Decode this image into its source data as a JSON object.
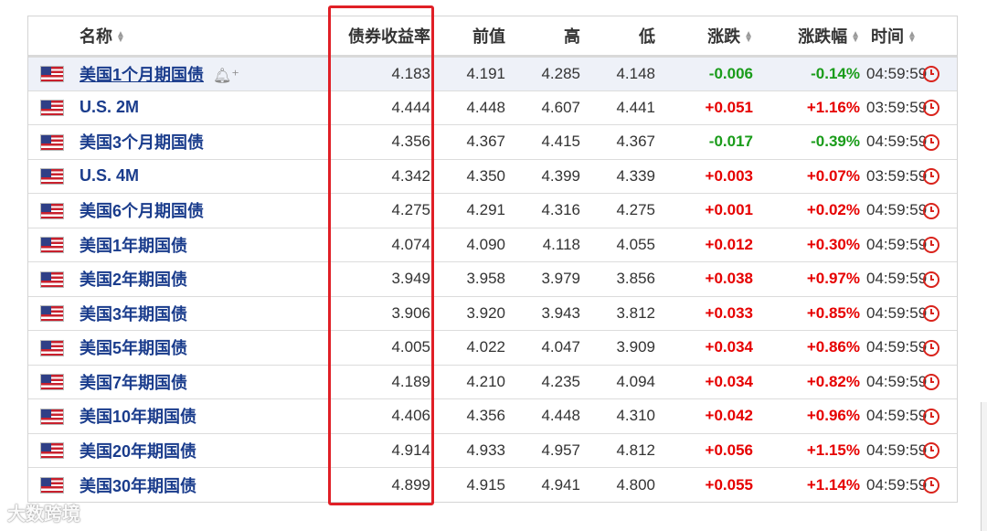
{
  "headers": {
    "name": "名称",
    "yield": "债券收益率",
    "prev": "前值",
    "high": "高",
    "low": "低",
    "change": "涨跌",
    "change_pct": "涨跌幅",
    "time": "时间"
  },
  "rows": [
    {
      "name": "美国1个月期国债",
      "yield": "4.183",
      "prev": "4.191",
      "high": "4.285",
      "low": "4.148",
      "change": "-0.006",
      "change_pct": "-0.14%",
      "time": "04:59:59",
      "dir": "down"
    },
    {
      "name": "U.S. 2M",
      "yield": "4.444",
      "prev": "4.448",
      "high": "4.607",
      "low": "4.441",
      "change": "+0.051",
      "change_pct": "+1.16%",
      "time": "03:59:59",
      "dir": "up"
    },
    {
      "name": "美国3个月期国债",
      "yield": "4.356",
      "prev": "4.367",
      "high": "4.415",
      "low": "4.367",
      "change": "-0.017",
      "change_pct": "-0.39%",
      "time": "04:59:59",
      "dir": "down"
    },
    {
      "name": "U.S. 4M",
      "yield": "4.342",
      "prev": "4.350",
      "high": "4.399",
      "low": "4.339",
      "change": "+0.003",
      "change_pct": "+0.07%",
      "time": "03:59:59",
      "dir": "up"
    },
    {
      "name": "美国6个月期国债",
      "yield": "4.275",
      "prev": "4.291",
      "high": "4.316",
      "low": "4.275",
      "change": "+0.001",
      "change_pct": "+0.02%",
      "time": "04:59:59",
      "dir": "up"
    },
    {
      "name": "美国1年期国债",
      "yield": "4.074",
      "prev": "4.090",
      "high": "4.118",
      "low": "4.055",
      "change": "+0.012",
      "change_pct": "+0.30%",
      "time": "04:59:59",
      "dir": "up"
    },
    {
      "name": "美国2年期国债",
      "yield": "3.949",
      "prev": "3.958",
      "high": "3.979",
      "low": "3.856",
      "change": "+0.038",
      "change_pct": "+0.97%",
      "time": "04:59:59",
      "dir": "up"
    },
    {
      "name": "美国3年期国债",
      "yield": "3.906",
      "prev": "3.920",
      "high": "3.943",
      "low": "3.812",
      "change": "+0.033",
      "change_pct": "+0.85%",
      "time": "04:59:59",
      "dir": "up"
    },
    {
      "name": "美国5年期国债",
      "yield": "4.005",
      "prev": "4.022",
      "high": "4.047",
      "low": "3.909",
      "change": "+0.034",
      "change_pct": "+0.86%",
      "time": "04:59:59",
      "dir": "up"
    },
    {
      "name": "美国7年期国债",
      "yield": "4.189",
      "prev": "4.210",
      "high": "4.235",
      "low": "4.094",
      "change": "+0.034",
      "change_pct": "+0.82%",
      "time": "04:59:59",
      "dir": "up"
    },
    {
      "name": "美国10年期国债",
      "yield": "4.406",
      "prev": "4.356",
      "high": "4.448",
      "low": "4.310",
      "change": "+0.042",
      "change_pct": "+0.96%",
      "time": "04:59:59",
      "dir": "up"
    },
    {
      "name": "美国20年期国债",
      "yield": "4.914",
      "prev": "4.933",
      "high": "4.957",
      "low": "4.812",
      "change": "+0.056",
      "change_pct": "+1.15%",
      "time": "04:59:59",
      "dir": "up"
    },
    {
      "name": "美国30年期国债",
      "yield": "4.899",
      "prev": "4.915",
      "high": "4.941",
      "low": "4.800",
      "change": "+0.055",
      "change_pct": "+1.14%",
      "time": "04:59:59",
      "dir": "up"
    }
  ],
  "icons": {
    "flag": "us-flag-icon",
    "clock": "clock-icon",
    "bell": "bell-plus-icon",
    "sort": "sort-arrows-icon"
  },
  "colors": {
    "up": "#e60000",
    "down": "#1a9c1a",
    "link": "#1a3c8c",
    "highlight_border": "#e01f26"
  },
  "watermark": "大数跨境"
}
